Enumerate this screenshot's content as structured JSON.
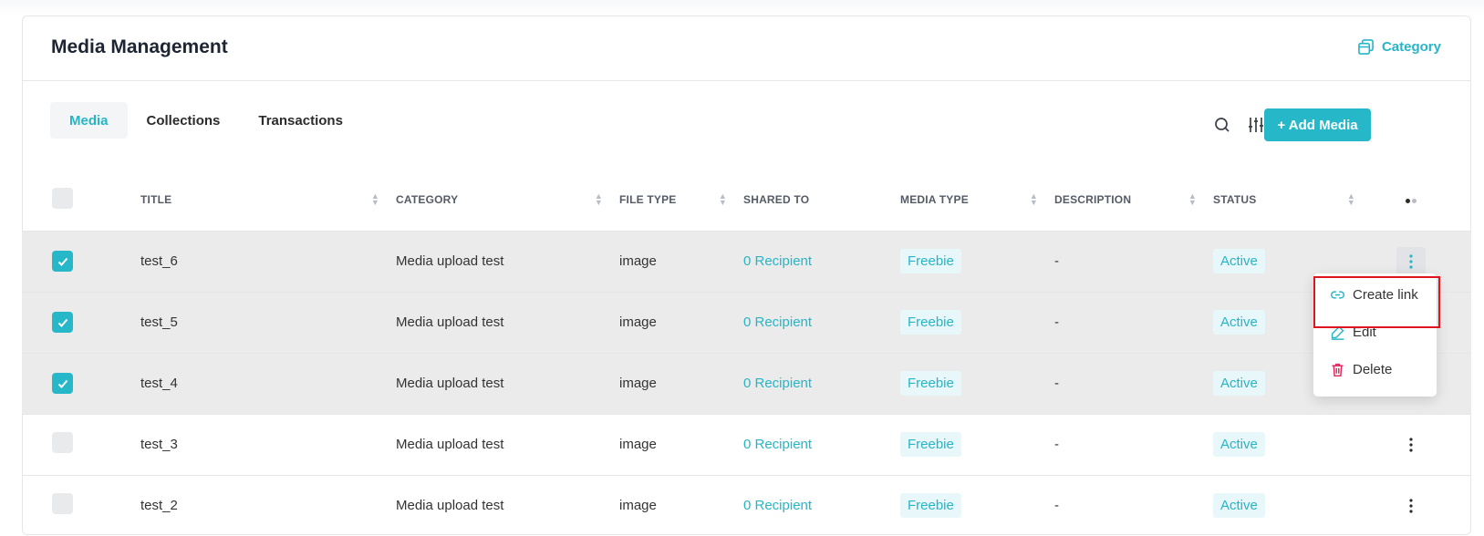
{
  "header": {
    "title": "Media Management",
    "category_link": "Category"
  },
  "tabs": [
    {
      "label": "Media",
      "active": true
    },
    {
      "label": "Collections",
      "active": false
    },
    {
      "label": "Transactions",
      "active": false
    }
  ],
  "toolbar": {
    "icons": [
      "search-icon",
      "filter-sliders-icon",
      "export-document-icon",
      "more-vertical-icon"
    ],
    "add_button": "+ Add Media"
  },
  "table": {
    "columns": [
      "TITLE",
      "CATEGORY",
      "FILE TYPE",
      "SHARED TO",
      "MEDIA TYPE",
      "DESCRIPTION",
      "STATUS"
    ],
    "rows": [
      {
        "checked": true,
        "title": "test_6",
        "category": "Media upload test",
        "file_type": "image",
        "shared_to": "0 Recipient",
        "media_type": "Freebie",
        "description": "-",
        "status": "Active"
      },
      {
        "checked": true,
        "title": "test_5",
        "category": "Media upload test",
        "file_type": "image",
        "shared_to": "0 Recipient",
        "media_type": "Freebie",
        "description": "-",
        "status": "Active"
      },
      {
        "checked": true,
        "title": "test_4",
        "category": "Media upload test",
        "file_type": "image",
        "shared_to": "0 Recipient",
        "media_type": "Freebie",
        "description": "-",
        "status": "Active"
      },
      {
        "checked": false,
        "title": "test_3",
        "category": "Media upload test",
        "file_type": "image",
        "shared_to": "0 Recipient",
        "media_type": "Freebie",
        "description": "-",
        "status": "Active"
      },
      {
        "checked": false,
        "title": "test_2",
        "category": "Media upload test",
        "file_type": "image",
        "shared_to": "0 Recipient",
        "media_type": "Freebie",
        "description": "-",
        "status": "Active"
      }
    ]
  },
  "context_menu": {
    "items": [
      {
        "label": "Create link",
        "icon": "link-icon"
      },
      {
        "label": "Edit",
        "icon": "pencil-icon"
      },
      {
        "label": "Delete",
        "icon": "trash-icon"
      }
    ]
  },
  "colors": {
    "accent": "#26b8c8",
    "selected_row": "#ebebeb",
    "highlight": "#e0141e",
    "danger": "#e0245e"
  }
}
